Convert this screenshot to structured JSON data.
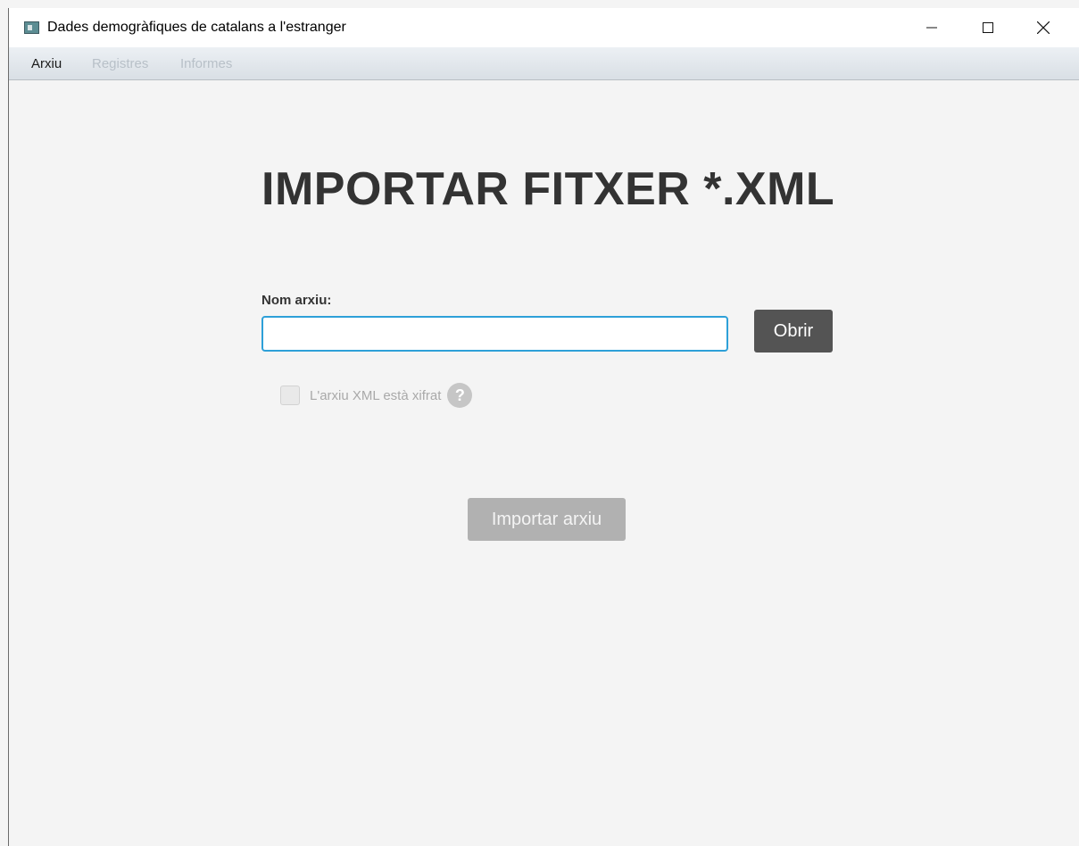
{
  "window": {
    "title": "Dades demogràfiques de catalans a l'estranger",
    "app_icon": "app-window-icon",
    "controls": {
      "minimize": "—",
      "maximize": "☐",
      "close": "✕"
    }
  },
  "menubar": {
    "items": [
      {
        "label": "Arxiu",
        "enabled": true
      },
      {
        "label": "Registres",
        "enabled": false
      },
      {
        "label": "Informes",
        "enabled": false
      }
    ]
  },
  "main": {
    "heading": "IMPORTAR FITXER *.XML",
    "file_label": "Nom arxiu:",
    "file_input_value": "",
    "open_button": "Obrir",
    "encrypted_checkbox": {
      "label": "L'arxiu XML està xifrat",
      "checked": false,
      "enabled": false
    },
    "help_glyph": "?",
    "import_button": "Importar arxiu"
  },
  "colors": {
    "focus_border": "#2ea0d8",
    "open_button_bg": "#545454",
    "import_button_disabled_bg": "#b1b1b1",
    "background": "#f4f4f4"
  }
}
